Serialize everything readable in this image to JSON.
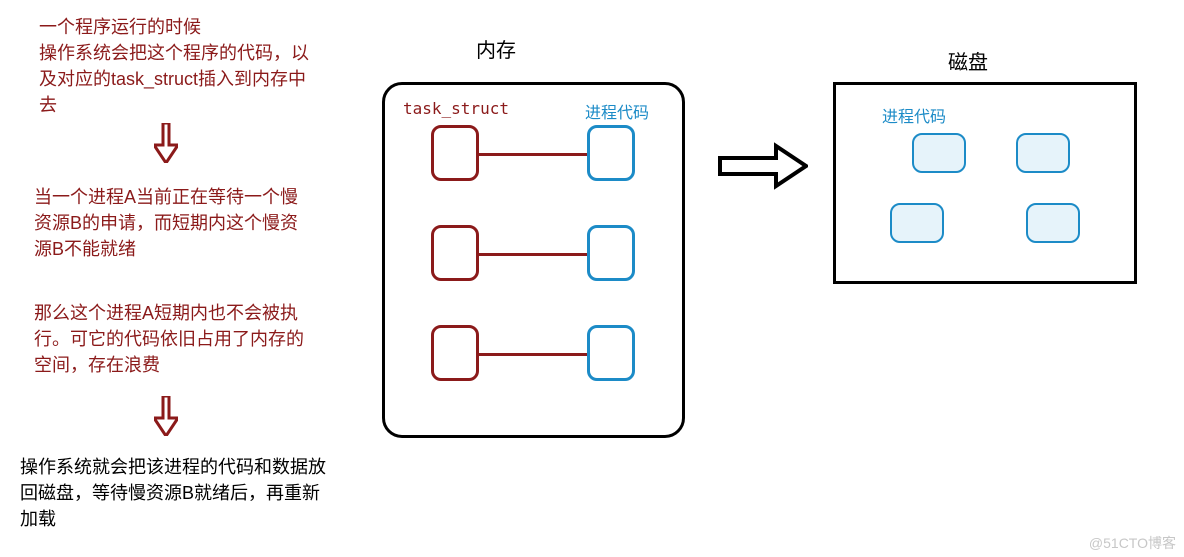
{
  "left_text": {
    "p1": "一个程序运行的时候\n操作系统会把这个程序的代码，以及对应的task_struct插入到内存中去",
    "p2": "当一个进程A当前正在等待一个慢资源B的申请，而短期内这个慢资源B不能就绪",
    "p3": "那么这个进程A短期内也不会被执行。可它的代码依旧占用了内存的空间，存在浪费",
    "p4": "操作系统就会把该进程的代码和数据放回磁盘，等待慢资源B就绪后，再重新加载"
  },
  "labels": {
    "memory": "内存",
    "disk": "磁盘",
    "task_struct": "task_struct",
    "proc_code": "进程代码",
    "proc_code_disk": "进程代码"
  },
  "colors": {
    "red": "#8B1A1A",
    "blue": "#1C8BC7",
    "black": "#000000",
    "disk_fill": "#E6F3FA"
  },
  "watermark": "@51CTO博客"
}
